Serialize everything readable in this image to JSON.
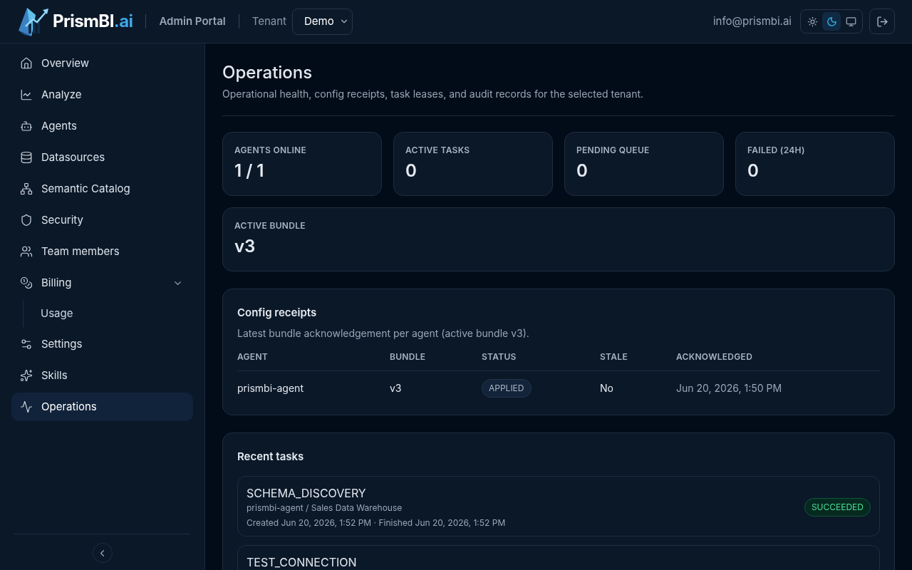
{
  "header": {
    "brand": {
      "name": "PrismBI",
      "suffix": ".ai"
    },
    "portal": "Admin Portal",
    "tenant_label": "Tenant",
    "tenant_value": "Demo",
    "email": "info@prismbi.ai",
    "theme_options": [
      {
        "kind": "light",
        "selected": false
      },
      {
        "kind": "dark",
        "selected": true
      },
      {
        "kind": "system",
        "selected": false
      }
    ]
  },
  "sidebar": {
    "items": [
      {
        "kind": "home",
        "label": "Overview",
        "selected": false
      },
      {
        "kind": "chart",
        "label": "Analyze",
        "selected": false
      },
      {
        "kind": "bot",
        "label": "Agents",
        "selected": false
      },
      {
        "kind": "database",
        "label": "Datasources",
        "selected": false
      },
      {
        "kind": "network",
        "label": "Semantic Catalog",
        "selected": false
      },
      {
        "kind": "shield",
        "label": "Security",
        "selected": false
      },
      {
        "kind": "users",
        "label": "Team members",
        "selected": false
      },
      {
        "kind": "coins",
        "label": "Billing",
        "selected": false,
        "expanded": true,
        "children": [
          {
            "label": "Usage",
            "selected": false
          }
        ]
      },
      {
        "kind": "sliders",
        "label": "Settings",
        "selected": false
      },
      {
        "kind": "sparkles",
        "label": "Skills",
        "selected": false
      },
      {
        "kind": "activity",
        "label": "Operations",
        "selected": true
      }
    ]
  },
  "page": {
    "title": "Operations",
    "subtitle": "Operational health, config receipts, task leases, and audit records for the selected tenant."
  },
  "stats": [
    {
      "label": "AGENTS ONLINE",
      "value": "1 / 1"
    },
    {
      "label": "ACTIVE TASKS",
      "value": "0"
    },
    {
      "label": "PENDING QUEUE",
      "value": "0"
    },
    {
      "label": "FAILED (24H)",
      "value": "0"
    }
  ],
  "bundle": {
    "label": "ACTIVE BUNDLE",
    "value": "v3"
  },
  "config_receipts": {
    "title": "Config receipts",
    "subtitle": "Latest bundle acknowledgement per agent (active bundle v3).",
    "columns": [
      "AGENT",
      "BUNDLE",
      "STATUS",
      "STALE",
      "ACKNOWLEDGED"
    ],
    "rows": [
      {
        "agent": "prismbi-agent",
        "bundle": "v3",
        "status": "APPLIED",
        "stale": "No",
        "acknowledged": "Jun 20, 2026, 1:50 PM"
      }
    ]
  },
  "recent_tasks": {
    "title": "Recent tasks",
    "items": [
      {
        "name": "SCHEMA_DISCOVERY",
        "source": "prismbi-agent / Sales Data Warehouse",
        "times": "Created Jun 20, 2026, 1:52 PM · Finished Jun 20, 2026, 1:52 PM",
        "status": "SUCCEEDED"
      },
      {
        "name": "TEST_CONNECTION"
      }
    ]
  }
}
